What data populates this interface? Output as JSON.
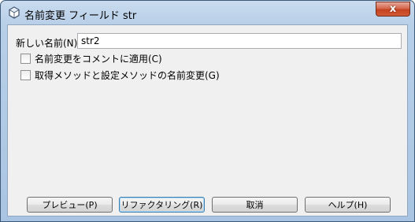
{
  "window": {
    "title": "名前変更 フィールド str",
    "close_glyph": "x",
    "icon": "netbeans-cube-icon"
  },
  "form": {
    "new_name_label": "新しい名前(N):",
    "new_name_value": "str2",
    "checkbox_comments_label": "名前変更をコメントに適用(C)",
    "checkbox_comments_checked": false,
    "checkbox_accessors_label": "取得メソッドと設定メソッドの名前変更(G)",
    "checkbox_accessors_checked": false
  },
  "buttons": {
    "preview": "プレビュー(P)",
    "refactor": "リファクタリング(R)",
    "cancel": "取消",
    "help": "ヘルプ(H)"
  }
}
